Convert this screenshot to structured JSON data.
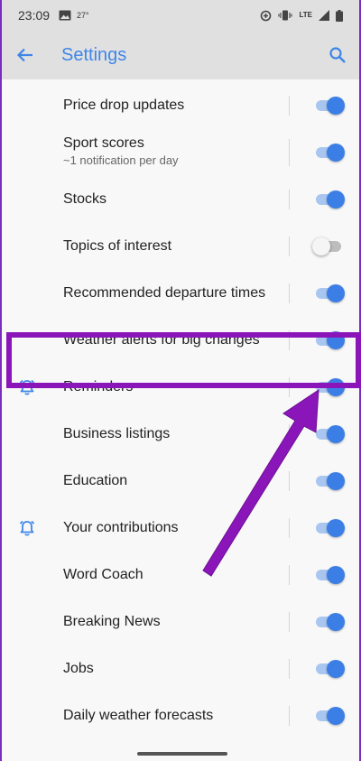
{
  "status": {
    "time": "23:09",
    "temperature": "27°",
    "network": "LTE",
    "icons": [
      "image-icon",
      "data-saver-icon",
      "vibrate-icon",
      "signal-icon",
      "battery-icon"
    ]
  },
  "header": {
    "title": "Settings",
    "back_icon": "arrow-back-icon",
    "search_icon": "search-icon"
  },
  "settings": [
    {
      "label": "Price drop updates",
      "sub": "",
      "on": true,
      "icon": ""
    },
    {
      "label": "Sport scores",
      "sub": "~1 notification per day",
      "on": true,
      "icon": ""
    },
    {
      "label": "Stocks",
      "sub": "",
      "on": true,
      "icon": ""
    },
    {
      "label": "Topics of interest",
      "sub": "",
      "on": false,
      "icon": ""
    },
    {
      "label": "Recommended departure times",
      "sub": "",
      "on": true,
      "icon": ""
    },
    {
      "label": "Weather alerts for big changes",
      "sub": "",
      "on": true,
      "icon": ""
    },
    {
      "label": "Reminders",
      "sub": "",
      "on": true,
      "icon": "alarm-bell-icon"
    },
    {
      "label": "Business listings",
      "sub": "",
      "on": true,
      "icon": ""
    },
    {
      "label": "Education",
      "sub": "",
      "on": true,
      "icon": ""
    },
    {
      "label": "Your contributions",
      "sub": "",
      "on": true,
      "icon": "alarm-bell-icon"
    },
    {
      "label": "Word Coach",
      "sub": "",
      "on": true,
      "icon": ""
    },
    {
      "label": "Breaking News",
      "sub": "",
      "on": true,
      "icon": ""
    },
    {
      "label": "Jobs",
      "sub": "",
      "on": true,
      "icon": ""
    },
    {
      "label": "Daily weather forecasts",
      "sub": "",
      "on": true,
      "icon": ""
    }
  ],
  "colors": {
    "accent": "#3b7fe6",
    "highlight": "#8a16b9",
    "app_bar": "#e0e0e0"
  }
}
